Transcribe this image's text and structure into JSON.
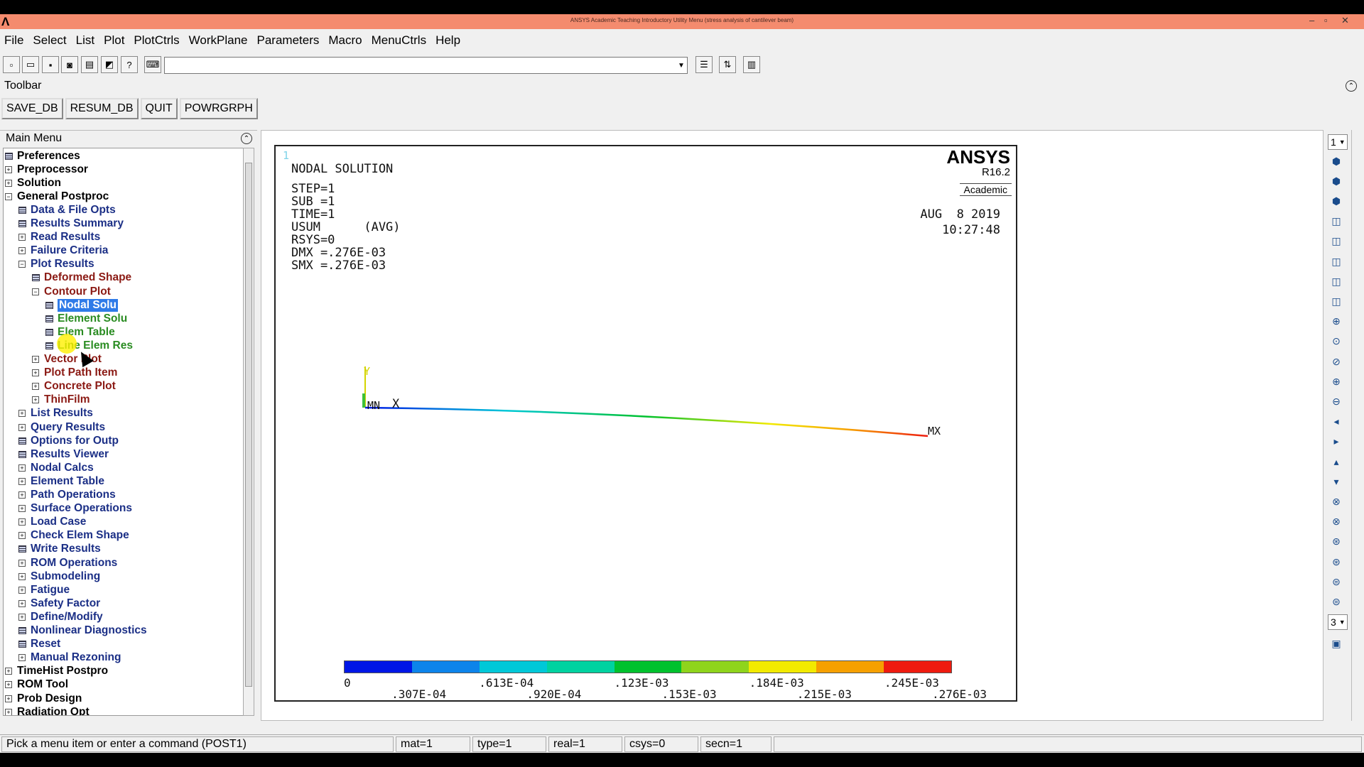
{
  "window": {
    "title": "ANSYS Academic Teaching Introductory Utility Menu (stress analysis of cantilever beam)",
    "logo": "Λ",
    "controls": [
      "–",
      "▫",
      "✕"
    ]
  },
  "menubar": [
    "File",
    "Select",
    "List",
    "Plot",
    "PlotCtrls",
    "WorkPlane",
    "Parameters",
    "Macro",
    "MenuCtrls",
    "Help"
  ],
  "command_input": {
    "value": ""
  },
  "toolbar": {
    "label": "Toolbar",
    "buttons": [
      "SAVE_DB",
      "RESUM_DB",
      "QUIT",
      "POWRGRPH"
    ]
  },
  "main_menu": {
    "title": "Main Menu",
    "items": [
      {
        "label": "Preferences",
        "level": 0,
        "kind": "icon",
        "color": "black"
      },
      {
        "label": "Preprocessor",
        "level": 0,
        "kind": "plus",
        "color": "black"
      },
      {
        "label": "Solution",
        "level": 0,
        "kind": "plus",
        "color": "black"
      },
      {
        "label": "General Postproc",
        "level": 0,
        "kind": "minus",
        "color": "black"
      },
      {
        "label": "Data & File Opts",
        "level": 1,
        "kind": "icon",
        "color": "navy"
      },
      {
        "label": "Results Summary",
        "level": 1,
        "kind": "icon",
        "color": "navy"
      },
      {
        "label": "Read Results",
        "level": 1,
        "kind": "plus",
        "color": "navy"
      },
      {
        "label": "Failure Criteria",
        "level": 1,
        "kind": "plus",
        "color": "navy"
      },
      {
        "label": "Plot Results",
        "level": 1,
        "kind": "minus",
        "color": "navy"
      },
      {
        "label": "Deformed Shape",
        "level": 2,
        "kind": "icon",
        "color": "red"
      },
      {
        "label": "Contour Plot",
        "level": 2,
        "kind": "minus",
        "color": "red"
      },
      {
        "label": "Nodal Solu",
        "level": 3,
        "kind": "icon",
        "color": "sel"
      },
      {
        "label": "Element Solu",
        "level": 3,
        "kind": "icon",
        "color": "green"
      },
      {
        "label": "Elem Table",
        "level": 3,
        "kind": "icon",
        "color": "green"
      },
      {
        "label": "Line Elem Res",
        "level": 3,
        "kind": "icon",
        "color": "green"
      },
      {
        "label": "Vector Plot",
        "level": 2,
        "kind": "plus",
        "color": "red"
      },
      {
        "label": "Plot Path Item",
        "level": 2,
        "kind": "plus",
        "color": "red"
      },
      {
        "label": "Concrete Plot",
        "level": 2,
        "kind": "plus",
        "color": "red"
      },
      {
        "label": "ThinFilm",
        "level": 2,
        "kind": "plus",
        "color": "red"
      },
      {
        "label": "List Results",
        "level": 1,
        "kind": "plus",
        "color": "navy"
      },
      {
        "label": "Query Results",
        "level": 1,
        "kind": "plus",
        "color": "navy"
      },
      {
        "label": "Options for Outp",
        "level": 1,
        "kind": "icon",
        "color": "navy"
      },
      {
        "label": "Results Viewer",
        "level": 1,
        "kind": "icon",
        "color": "navy"
      },
      {
        "label": "Nodal Calcs",
        "level": 1,
        "kind": "plus",
        "color": "navy"
      },
      {
        "label": "Element Table",
        "level": 1,
        "kind": "plus",
        "color": "navy"
      },
      {
        "label": "Path Operations",
        "level": 1,
        "kind": "plus",
        "color": "navy"
      },
      {
        "label": "Surface Operations",
        "level": 1,
        "kind": "plus",
        "color": "navy"
      },
      {
        "label": "Load Case",
        "level": 1,
        "kind": "plus",
        "color": "navy"
      },
      {
        "label": "Check Elem Shape",
        "level": 1,
        "kind": "plus",
        "color": "navy"
      },
      {
        "label": "Write Results",
        "level": 1,
        "kind": "icon",
        "color": "navy"
      },
      {
        "label": "ROM Operations",
        "level": 1,
        "kind": "plus",
        "color": "navy"
      },
      {
        "label": "Submodeling",
        "level": 1,
        "kind": "plus",
        "color": "navy"
      },
      {
        "label": "Fatigue",
        "level": 1,
        "kind": "plus",
        "color": "navy"
      },
      {
        "label": "Safety Factor",
        "level": 1,
        "kind": "plus",
        "color": "navy"
      },
      {
        "label": "Define/Modify",
        "level": 1,
        "kind": "plus",
        "color": "navy"
      },
      {
        "label": "Nonlinear Diagnostics",
        "level": 1,
        "kind": "icon",
        "color": "navy"
      },
      {
        "label": "Reset",
        "level": 1,
        "kind": "icon",
        "color": "navy"
      },
      {
        "label": "Manual Rezoning",
        "level": 1,
        "kind": "plus",
        "color": "navy"
      },
      {
        "label": "TimeHist Postpro",
        "level": 0,
        "kind": "plus",
        "color": "black"
      },
      {
        "label": "ROM Tool",
        "level": 0,
        "kind": "plus",
        "color": "black"
      },
      {
        "label": "Prob Design",
        "level": 0,
        "kind": "plus",
        "color": "black"
      },
      {
        "label": "Radiation Opt",
        "level": 0,
        "kind": "plus",
        "color": "black"
      }
    ]
  },
  "plot": {
    "window_number": "1",
    "heading": "NODAL SOLUTION",
    "info_lines": [
      "STEP=1",
      "SUB =1",
      "TIME=1",
      "USUM      (AVG)",
      "RSYS=0",
      "DMX =.276E-03",
      "SMX =.276E-03"
    ],
    "brand": "ANSYS",
    "release": "R16.2",
    "edition": "Academic",
    "date": "AUG  8 2019",
    "time": "10:27:48",
    "triad_y": "Y",
    "triad_x": "X",
    "node_label": "MN",
    "max_label": "MX",
    "legend_colors": [
      "#0016e6",
      "#0d84ea",
      "#00c8d8",
      "#00d2a0",
      "#00c12d",
      "#8fd41c",
      "#f2ea00",
      "#f6a000",
      "#ee1b0f"
    ],
    "legend_labels_top": [
      "0",
      ".613E-04",
      ".123E-03",
      ".184E-03",
      ".245E-03"
    ],
    "legend_labels_bottom": [
      ".307E-04",
      ".920E-04",
      ".153E-03",
      ".215E-03",
      ".276E-03"
    ]
  },
  "right_toolbar": {
    "window_select": "1",
    "zoom_select": "3",
    "icons": [
      "iso-view-icon",
      "front-view-icon",
      "top-view-icon",
      "back-view-icon",
      "right-view-icon",
      "left-view-icon",
      "bottom-view-icon",
      "oblique-view-icon",
      "zoom-icon",
      "box-zoom-icon",
      "win-zoom-icon",
      "zoom-in-icon",
      "zoom-out-icon",
      "pan-left-icon",
      "pan-right-icon",
      "pan-up-icon",
      "pan-down-icon",
      "rotate-x-icon",
      "rotate-x-neg-icon",
      "rotate-y-icon",
      "rotate-y-neg-icon",
      "rotate-z-icon",
      "rotate-z-neg-icon"
    ]
  },
  "status": {
    "prompt": "Pick a menu item or enter a command (POST1)",
    "mat": "mat=1",
    "type": "type=1",
    "real": "real=1",
    "csys": "csys=0",
    "secn": "secn=1"
  }
}
